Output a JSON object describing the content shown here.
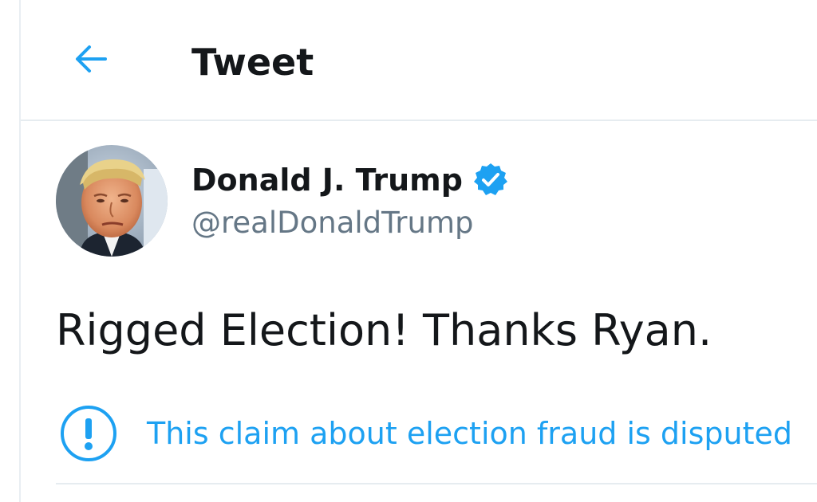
{
  "header": {
    "title": "Tweet",
    "back_icon": "arrow-left-icon"
  },
  "tweet": {
    "author": {
      "display_name": "Donald J. Trump",
      "handle": "@realDonaldTrump",
      "verified": true,
      "verified_icon": "verified-badge-icon",
      "avatar_icon": "avatar-portrait"
    },
    "text": "Rigged Election! Thanks Ryan.",
    "label": {
      "icon": "exclamation-circle-icon",
      "text": "This claim about election fraud is disputed"
    }
  },
  "colors": {
    "accent": "#1da1f2",
    "text_primary": "#14171a",
    "text_secondary": "#657786",
    "divider": "#e6ecf0"
  }
}
